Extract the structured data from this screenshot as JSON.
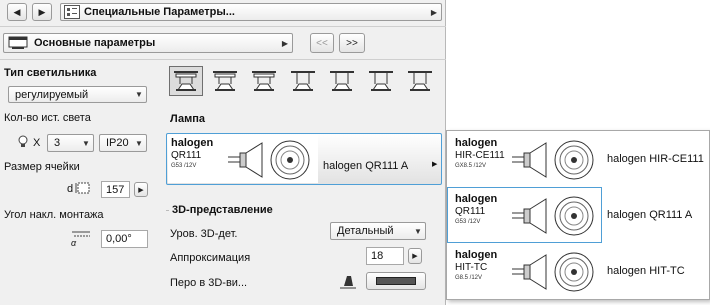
{
  "header": {
    "title": "Специальные Параметры...",
    "prev": "◀",
    "next": "▶"
  },
  "subheader": {
    "page": "Основные параметры",
    "btn_prev": "<<",
    "btn_next": ">>"
  },
  "left": {
    "fixture_type_label": "Тип светильника",
    "fixture_type_value": "регулируемый",
    "source_count_label": "Кол-во ист. света",
    "source_x": "X",
    "source_count_value": "3",
    "ip_value": "IP20",
    "cell_size_label": "Размер ячейки",
    "cell_d": "d",
    "cell_size_value": "157",
    "angle_label": "Угол накл. монтажа",
    "angle_symbol": "α",
    "angle_value": "0,00°"
  },
  "lamp": {
    "section": "Лампа",
    "brand": "halogen",
    "model": "QR111",
    "spec": "G53 /12V",
    "name": "halogen QR111 A"
  },
  "rep3d": {
    "section": "3D-представление",
    "level_label": "Уров. 3D-дет.",
    "level_value": "Детальный",
    "approx_label": "Аппроксимация",
    "approx_value": "18",
    "pen_label": "Перо в 3D-ви..."
  },
  "popup": [
    {
      "brand": "halogen",
      "model": "HIR-CE111",
      "spec": "GX8.5 /12V",
      "name": "halogen HIR-CE111"
    },
    {
      "brand": "halogen",
      "model": "QR111",
      "spec": "G53 /12V",
      "name": "halogen QR111 A"
    },
    {
      "brand": "halogen",
      "model": "HIT-TC",
      "spec": "G8.5 /12V",
      "name": "halogen HIT-TC"
    }
  ],
  "mount_types": [
    "mount-type-1-icon",
    "mount-type-2-icon",
    "mount-type-3-icon",
    "mount-type-4-icon",
    "mount-type-5-icon",
    "mount-type-6-icon",
    "mount-type-7-icon"
  ],
  "colors": {
    "accent_border": "#4f9fd6",
    "panel_bg": "#f0f0f0"
  }
}
